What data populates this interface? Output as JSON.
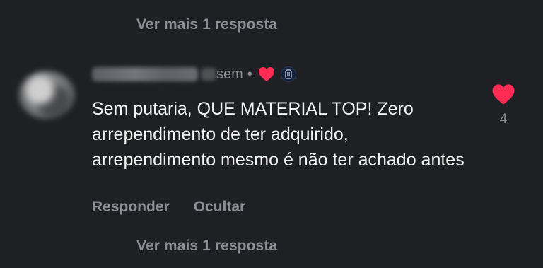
{
  "top_view_more": "Ver mais 1 resposta",
  "comment": {
    "age": "sem",
    "separator": "•",
    "text": "Sem putaria, QUE MATERIAL TOP! Zero arrependimento de ter adquirido, arrependimento mesmo é não ter achado antes",
    "reply_label": "Responder",
    "hide_label": "Ocultar",
    "like_count": "4",
    "liked_by_author": true
  },
  "bottom_view_more": "Ver mais 1 resposta",
  "colors": {
    "background": "#1f2023",
    "muted_text": "#8e8f94",
    "body_text": "#f2f2f2",
    "heart": "#fe2c55"
  },
  "icons": {
    "like": "heart-icon",
    "creator_like": "heart-icon",
    "badge": "creator-badge-icon"
  }
}
